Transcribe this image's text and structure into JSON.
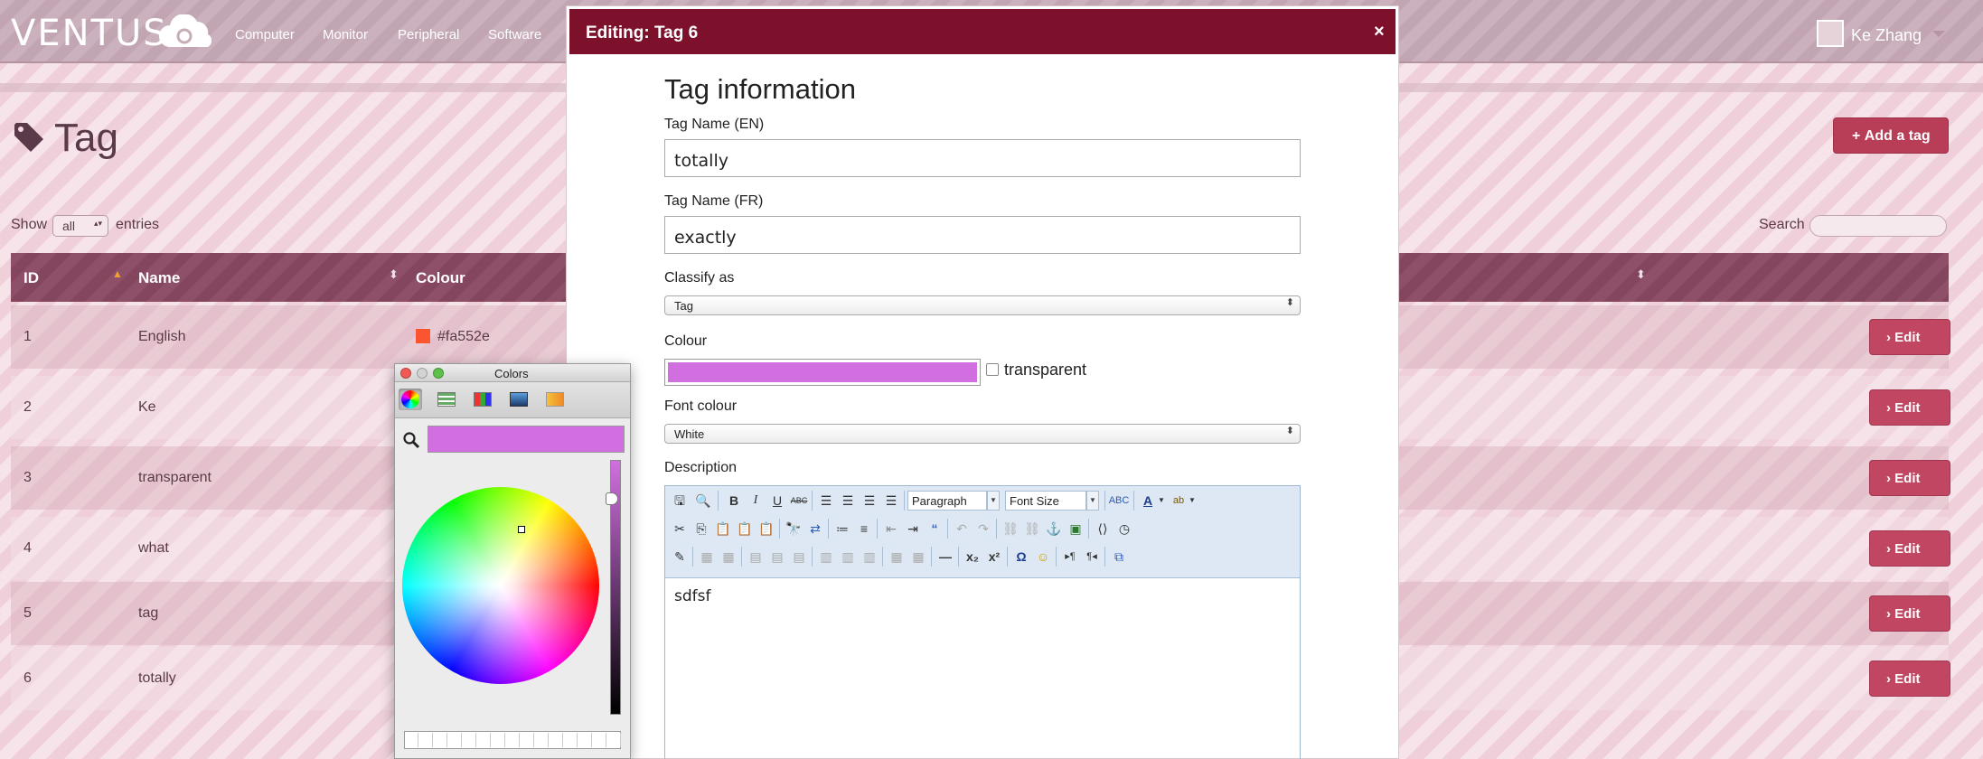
{
  "app": {
    "logo": "VENTUS",
    "nav": [
      "Computer",
      "Monitor",
      "Peripheral",
      "Software"
    ],
    "user_name": "Ke Zhang"
  },
  "page": {
    "title": "Tag",
    "add_button": "Add a tag",
    "show_label": "Show",
    "show_value": "all",
    "entries_label": "entries",
    "search_label": "Search"
  },
  "table": {
    "columns": [
      "ID",
      "Name",
      "Colour"
    ],
    "rows": [
      {
        "id": "1",
        "name": "English",
        "colour": "#fa552e",
        "swatch": "#fa552e"
      },
      {
        "id": "2",
        "name": "Ke",
        "colour": "",
        "swatch": ""
      },
      {
        "id": "3",
        "name": "transparent",
        "colour": "",
        "swatch": ""
      },
      {
        "id": "4",
        "name": "what",
        "colour": "",
        "swatch": ""
      },
      {
        "id": "5",
        "name": "tag",
        "colour": "",
        "swatch": ""
      },
      {
        "id": "6",
        "name": "totally",
        "colour": "",
        "swatch": ""
      }
    ],
    "edit_label": "Edit"
  },
  "modal": {
    "title": "Editing: Tag 6",
    "close": "×",
    "section_title": "Tag information",
    "name_en_label": "Tag Name (EN)",
    "name_en_value": "totally",
    "name_fr_label": "Tag Name (FR)",
    "name_fr_value": "exactly",
    "classify_label": "Classify as",
    "classify_value": "Tag",
    "colour_label": "Colour",
    "colour_value": "#d16fe0",
    "transparent_label": "transparent",
    "font_colour_label": "Font colour",
    "font_colour_value": "White",
    "description_label": "Description",
    "editor": {
      "paragraph": "Paragraph",
      "font_size": "Font Size",
      "content": "sdfsf"
    }
  },
  "colors_panel": {
    "title": "Colors",
    "current_colour": "#d16fe0"
  }
}
